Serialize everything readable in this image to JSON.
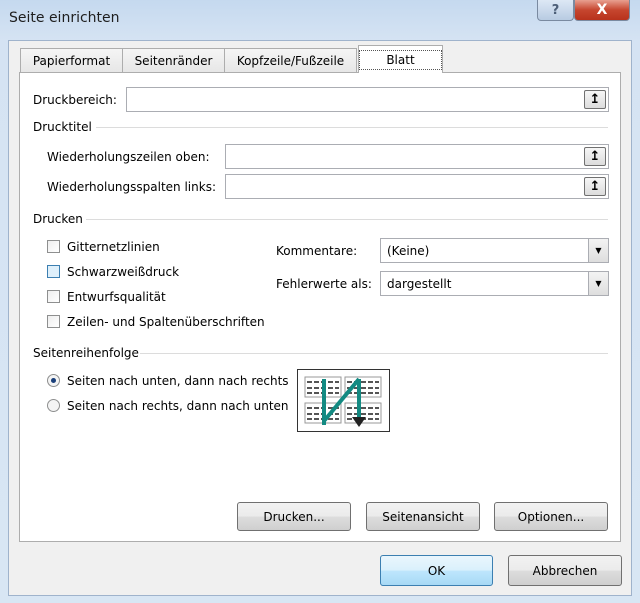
{
  "window": {
    "title": "Seite einrichten",
    "help": "?",
    "close": "X"
  },
  "tabs": [
    {
      "label": "Papierformat"
    },
    {
      "label": "Seitenränder"
    },
    {
      "label": "Kopfzeile/Fußzeile"
    },
    {
      "label": "Blatt",
      "selected": true
    }
  ],
  "print_area": {
    "label": "Druckbereich:",
    "value": ""
  },
  "print_titles": {
    "heading": "Drucktitel",
    "rows_label": "Wiederholungszeilen oben:",
    "rows_value": "",
    "cols_label": "Wiederholungsspalten links:",
    "cols_value": ""
  },
  "print": {
    "heading": "Drucken",
    "checkboxes": [
      {
        "label": "Gitternetzlinien",
        "checked": false
      },
      {
        "label": "Schwarzweißdruck",
        "checked": false
      },
      {
        "label": "Entwurfsqualität",
        "checked": false
      },
      {
        "label": "Zeilen- und Spaltenüberschriften",
        "checked": false
      }
    ],
    "comments_label": "Kommentare:",
    "comments_value": "(Keine)",
    "errors_label": "Fehlerwerte als:",
    "errors_value": "dargestellt"
  },
  "page_order": {
    "heading": "Seitenreihenfolge",
    "options": [
      {
        "label": "Seiten nach unten, dann nach rechts",
        "selected": true
      },
      {
        "label": "Seiten nach rechts, dann nach unten",
        "selected": false
      }
    ]
  },
  "buttons": {
    "print": "Drucken...",
    "preview": "Seitenansicht",
    "options": "Optionen...",
    "ok": "OK",
    "cancel": "Abbrechen"
  },
  "icons": {
    "pick": "↥"
  }
}
